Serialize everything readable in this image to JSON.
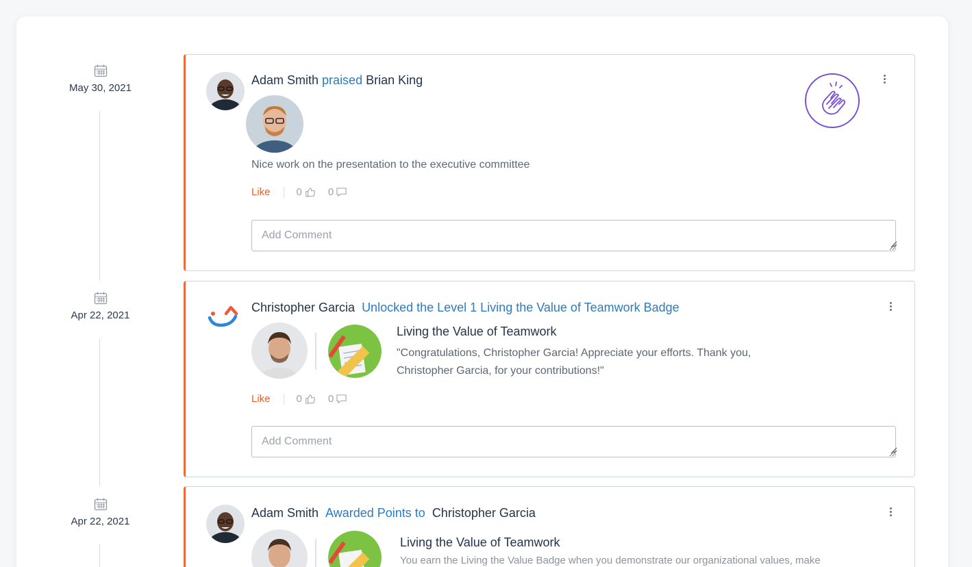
{
  "feed": [
    {
      "date": "May 30, 2021",
      "actor": "Adam Smith",
      "action": "praised",
      "target": "Brian King",
      "message": "Nice work on the presentation to the executive committee",
      "like_label": "Like",
      "likes": "0",
      "comments": "0",
      "comment_placeholder": "Add Comment",
      "icon": "clapping-hands-icon"
    },
    {
      "date": "Apr 22, 2021",
      "actor": "Christopher Garcia",
      "action": "Unlocked the Level 1 Living the Value of Teamwork Badge",
      "badge_title": "Living the Value of Teamwork",
      "badge_desc_1": "\"Congratulations, Christopher Garcia! Appreciate your efforts. Thank you,",
      "badge_desc_2": "Christopher Garcia, for your contributions!\"",
      "like_label": "Like",
      "likes": "0",
      "comments": "0",
      "comment_placeholder": "Add Comment"
    },
    {
      "date": "Apr 22, 2021",
      "actor": "Adam Smith",
      "action": "Awarded Points to",
      "target": "Christopher Garcia",
      "badge_title": "Living the Value of Teamwork",
      "badge_desc_1": "You earn the Living the Value Badge when you demonstrate our organizational values, make"
    }
  ],
  "colors": {
    "accent_bar": "#ef6a3a",
    "action_link": "#2a7bc4",
    "like": "#e8602e",
    "praise_ring": "#7b4fd1"
  }
}
